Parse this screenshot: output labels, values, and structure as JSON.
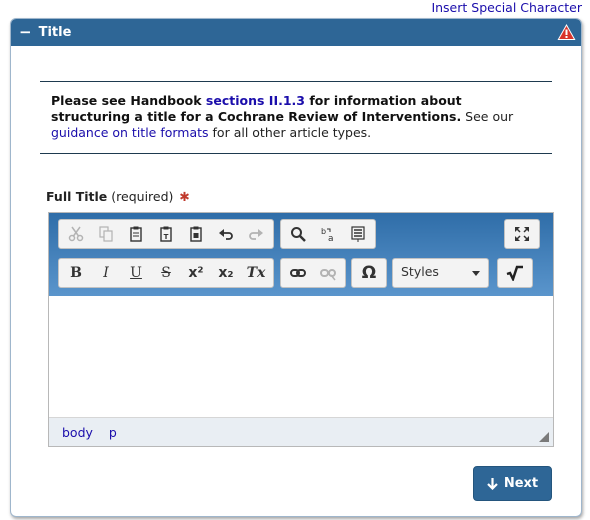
{
  "top_link": "Insert Special Character",
  "panel": {
    "toggle_symbol": "−",
    "title": "Title"
  },
  "info": {
    "part1": "Please see Handbook ",
    "link1": "sections II.1.3",
    "part2": " for information about structuring a title for a Cochrane Review of Interventions.",
    "part3": " See our ",
    "link2": "guidance on title formats",
    "part4": " for all other article types."
  },
  "field": {
    "label": "Full Title",
    "required": "(required)",
    "star": "✱"
  },
  "toolbar": {
    "styles_label": "Styles",
    "omega": "Ω",
    "bold": "B",
    "italic": "I",
    "underline": "U",
    "strike": "S",
    "superscript": "x²",
    "subscript": "x₂",
    "remove_format": "Tx"
  },
  "statusbar": {
    "path1": "body",
    "path2": "p"
  },
  "next_button": {
    "label": "Next"
  },
  "colors": {
    "header": "#2e6696",
    "link": "#1a0dab",
    "required": "#c0392b"
  }
}
